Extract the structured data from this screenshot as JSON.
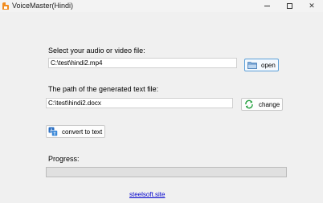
{
  "window": {
    "title": "VoiceMaster(Hindi)",
    "controls": {
      "minimize": "—",
      "maximize": "☐",
      "close": "✕"
    }
  },
  "input": {
    "label": "Select your audio or video file:",
    "value": "C:\\test\\hindi2.mp4",
    "button_label": "open",
    "button_icon": "folder-icon"
  },
  "output": {
    "label": "The path of the generated text file:",
    "value": "C:\\test\\hindi2.docx",
    "button_label": "change",
    "button_icon": "refresh-icon"
  },
  "convert": {
    "button_label": "convert to text",
    "button_icon": "translate-icon"
  },
  "progress": {
    "label": "Progress:",
    "value": 0
  },
  "footer": {
    "link_text": "steelsoft.site"
  },
  "colors": {
    "accent": "#5a9fd8",
    "link": "#0000cc",
    "progress_fill": "#06b025"
  }
}
